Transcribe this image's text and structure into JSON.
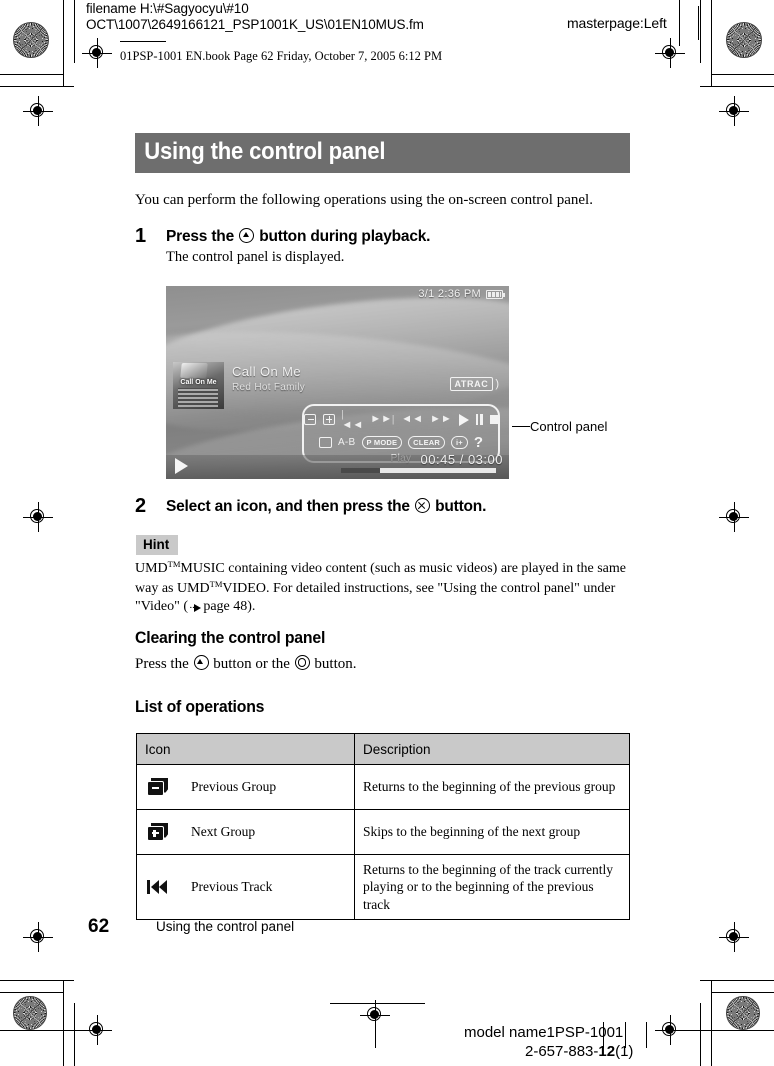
{
  "prepress": {
    "filename_line": "filename H:\\#Sagyocyu\\#10",
    "path_line": "OCT\\1007\\2649166121_PSP1001K_US\\01EN10MUS.fm",
    "masterpage": "masterpage:Left",
    "book_slug": "01PSP-1001 EN.book  Page 62  Friday, October 7, 2005  6:12 PM",
    "model_name": "model name1PSP-1001",
    "part_number_prefix": "2-657-883-",
    "part_number_bold": "12",
    "part_number_suffix": "(1)"
  },
  "page": {
    "title": "Using the control panel",
    "intro": "You can perform the following operations using the on-screen control panel.",
    "page_number": "62",
    "footer_title": "Using the control panel",
    "title_bar_color": "#6e6e6e",
    "hint_bg_color": "#c9c9c9"
  },
  "steps": [
    {
      "number": "1",
      "head_before": "Press the",
      "button_glyph": "triangle-button",
      "head_after": "button during playback.",
      "sub": "The control panel is displayed."
    },
    {
      "number": "2",
      "head_before": "Select an icon, and then press the",
      "button_glyph": "cross-button",
      "head_after": "button.",
      "sub": ""
    }
  ],
  "screenshot": {
    "status_time": "3/1 2:36 PM",
    "battery_icon": "battery-icon",
    "track_title": "Call On Me",
    "track_artist": "Red Hot Family",
    "album_art_caption": "Call On Me",
    "format_badge": "ATRAC",
    "panel_label": "Play",
    "elapsed_time": "00:45",
    "time_separator": "/",
    "total_time": "03:00",
    "progress_percent": 25,
    "callout": "Control panel",
    "panel_row1": [
      {
        "name": "previous-group-icon",
        "kind": "box-minus"
      },
      {
        "name": "next-group-icon",
        "kind": "box-plus"
      },
      {
        "name": "previous-track-icon",
        "kind": "glyph",
        "text": "|◄◄"
      },
      {
        "name": "next-track-icon",
        "kind": "glyph",
        "text": "►►|"
      },
      {
        "name": "fast-reverse-icon",
        "kind": "glyph",
        "text": "◄◄"
      },
      {
        "name": "fast-forward-icon",
        "kind": "glyph",
        "text": "►►"
      },
      {
        "name": "play-icon",
        "kind": "triangle"
      },
      {
        "name": "pause-icon",
        "kind": "pause"
      },
      {
        "name": "stop-icon",
        "kind": "stop"
      }
    ],
    "panel_row2": [
      {
        "name": "display-icon",
        "kind": "box-plain"
      },
      {
        "name": "ab-repeat-icon",
        "kind": "text",
        "text": "A-B"
      },
      {
        "name": "play-mode-icon",
        "kind": "pill",
        "text": "P MODE"
      },
      {
        "name": "clear-icon",
        "kind": "pill",
        "text": "CLEAR"
      },
      {
        "name": "info-icon",
        "kind": "pill",
        "text": "i+"
      },
      {
        "name": "help-icon",
        "kind": "question",
        "text": "?"
      }
    ]
  },
  "hint": {
    "label": "Hint",
    "text_1": "UMD",
    "tm_1": "TM",
    "text_2": "MUSIC containing video content (such as music videos) are played in the same way as UMD",
    "tm_2": "TM",
    "text_3": "VIDEO. For detailed instructions, see \"Using the control panel\" under \"Video\"",
    "ref_open": "(",
    "ref_page": "page 48",
    "ref_close": ")."
  },
  "clearing": {
    "heading": "Clearing the control panel",
    "text_before": "Press the",
    "glyph_1": "triangle-button",
    "text_middle": "button or the",
    "glyph_2": "circle-button",
    "text_after": "button."
  },
  "list_of_operations": {
    "heading": "List of operations",
    "columns": [
      "Icon",
      "Description"
    ],
    "rows": [
      {
        "icon_name": "previous-group-icon",
        "icon_kind": "box-minus",
        "label": "Previous Group",
        "description": "Returns to the beginning of the previous group"
      },
      {
        "icon_name": "next-group-icon",
        "icon_kind": "box-plus",
        "label": "Next Group",
        "description": "Skips to the beginning of the next group"
      },
      {
        "icon_name": "previous-track-icon",
        "icon_kind": "prev-track",
        "label": "Previous Track",
        "description": "Returns to the beginning of the track currently playing or to the beginning of the previous track"
      }
    ]
  }
}
